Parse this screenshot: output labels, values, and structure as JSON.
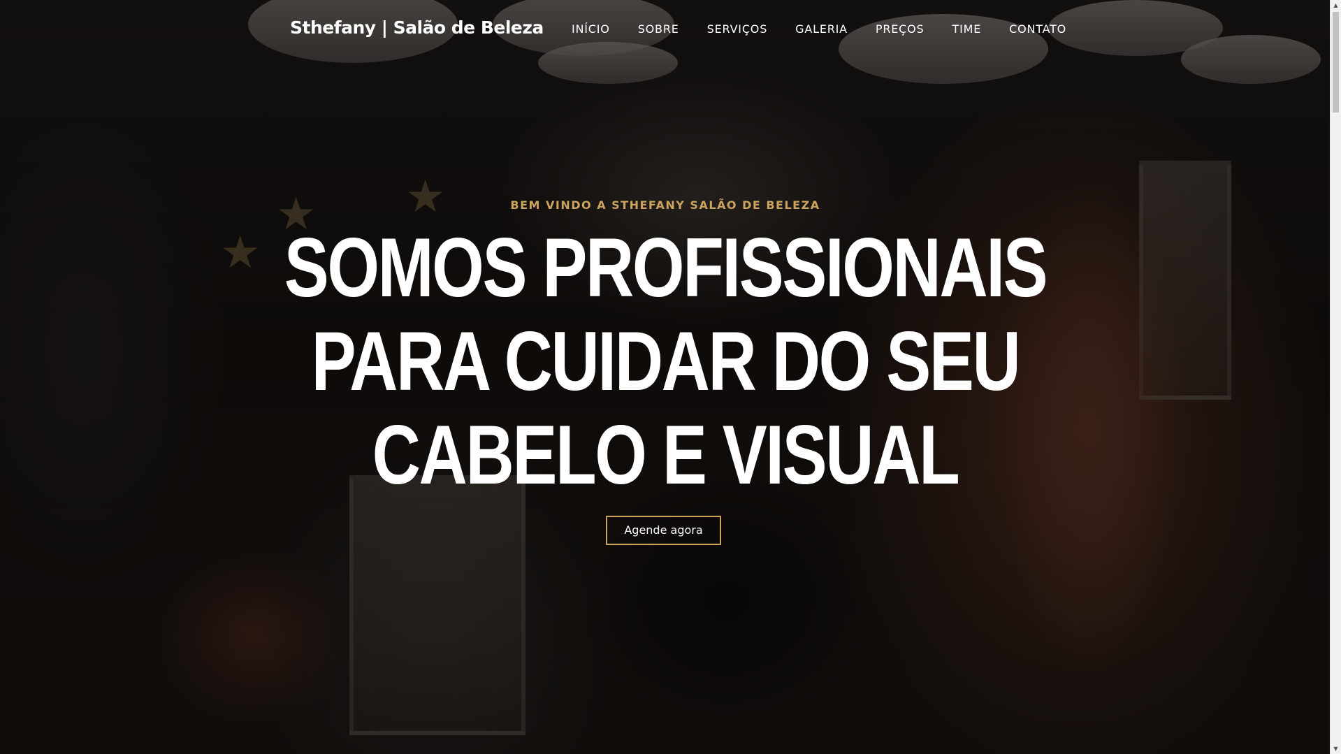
{
  "header": {
    "brand": "Sthefany | Salão de Beleza",
    "nav": [
      {
        "label": "INÍCIO"
      },
      {
        "label": "SOBRE"
      },
      {
        "label": "SERVIÇOS"
      },
      {
        "label": "GALERIA"
      },
      {
        "label": "PREÇOS"
      },
      {
        "label": "TIME"
      },
      {
        "label": "CONTATO"
      }
    ]
  },
  "hero": {
    "eyebrow": "BEM VINDO A STHEFANY SALÃO DE BELEZA",
    "headline_lines": [
      "SOMOS PROFISSIONAIS",
      "PARA CUIDAR DO SEU",
      "CABELO E VISUAL"
    ],
    "cta_label": "Agende agora",
    "background_icon": "salon-photo-icon"
  },
  "scrollbar": {
    "up_icon": "scroll-up-arrow-icon",
    "down_icon": "scroll-down-arrow-icon"
  },
  "colors": {
    "accent": "#cda45e",
    "text": "#ffffff",
    "overlay": "#000000"
  }
}
